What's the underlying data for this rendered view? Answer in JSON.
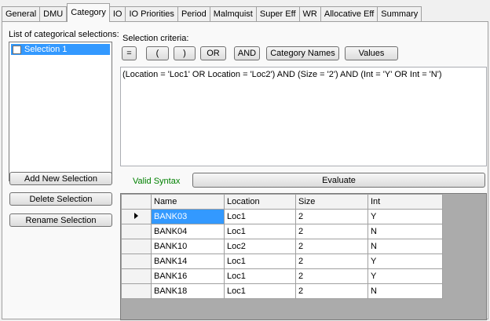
{
  "tabs": [
    {
      "label": "General",
      "active": false
    },
    {
      "label": "DMU",
      "active": false
    },
    {
      "label": "Category",
      "active": true
    },
    {
      "label": "IO",
      "active": false
    },
    {
      "label": "IO Priorities",
      "active": false
    },
    {
      "label": "Period",
      "active": false
    },
    {
      "label": "Malmquist",
      "active": false
    },
    {
      "label": "Super Eff",
      "active": false
    },
    {
      "label": "WR",
      "active": false
    },
    {
      "label": "Allocative Eff",
      "active": false
    },
    {
      "label": "Summary",
      "active": false
    }
  ],
  "left": {
    "list_label": "List of categorical selections:",
    "items": [
      {
        "label": "Selection 1",
        "checked": false,
        "selected": true
      }
    ],
    "add_button": "Add New Selection",
    "delete_button": "Delete Selection",
    "rename_button": "Rename Selection"
  },
  "criteria": {
    "label": "Selection criteria:",
    "buttons": {
      "equals": "=",
      "open_paren": "(",
      "close_paren": ")",
      "or": "OR",
      "and": "AND",
      "category_names": "Category Names",
      "values": "Values"
    },
    "expression": "(Location = 'Loc1' OR Location = 'Loc2') AND (Size = '2') AND (Int = 'Y' OR Int = 'N')",
    "status": "Valid Syntax",
    "status_color": "#008000",
    "evaluate_button": "Evaluate"
  },
  "grid": {
    "columns": [
      "Name",
      "Location",
      "Size",
      "Int"
    ],
    "rows": [
      [
        "BANK03",
        "Loc1",
        "2",
        "Y"
      ],
      [
        "BANK04",
        "Loc1",
        "2",
        "N"
      ],
      [
        "BANK10",
        "Loc2",
        "2",
        "N"
      ],
      [
        "BANK14",
        "Loc1",
        "2",
        "Y"
      ],
      [
        "BANK16",
        "Loc1",
        "2",
        "Y"
      ],
      [
        "BANK18",
        "Loc1",
        "2",
        "N"
      ]
    ],
    "current_row": 0,
    "selection_color": "#3399ff"
  }
}
